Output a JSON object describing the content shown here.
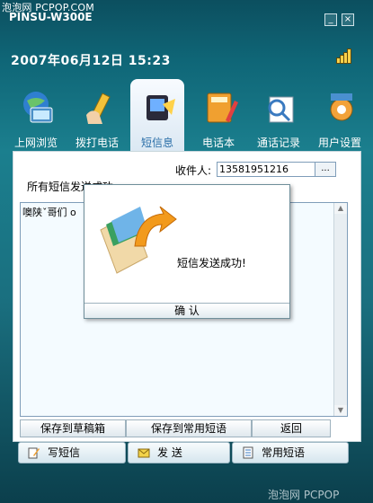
{
  "watermark": "泡泡网 PCPOP.COM",
  "window": {
    "title": "PINSU-W300E",
    "minimize": "_",
    "close": "×"
  },
  "status": {
    "datetime": "2007年06月12日  15:23"
  },
  "tabs": [
    {
      "label": "上网浏览",
      "icon": "globe-computer-icon"
    },
    {
      "label": "拨打电话",
      "icon": "phone-hand-icon"
    },
    {
      "label": "短信息",
      "icon": "message-icon",
      "active": true
    },
    {
      "label": "电话本",
      "icon": "contact-book-icon"
    },
    {
      "label": "通话记录",
      "icon": "call-log-icon"
    },
    {
      "label": "用户设置",
      "icon": "settings-gear-icon"
    }
  ],
  "compose": {
    "recipient_label": "收件人:",
    "recipient_value": "13581951216",
    "more_button": "...",
    "status_text": "所有短信发送成功",
    "message_text": "噢陕ˇ哥们 o"
  },
  "bottom_buttons": {
    "save_draft": "保存到草稿箱",
    "save_common": "保存到常用短语",
    "back": "返回"
  },
  "actions": {
    "write": "写短信",
    "send": "发 送",
    "common": "常用短语"
  },
  "dialog": {
    "message": "短信发送成功!",
    "ok": "确 认"
  },
  "footer_watermark": "泡泡网 PCPOP"
}
